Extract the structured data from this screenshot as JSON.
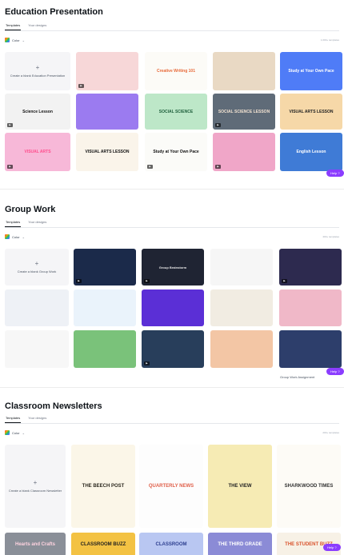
{
  "education": {
    "title": "Education Presentation",
    "tabs": [
      "Templates",
      "Your designs"
    ],
    "filter": "Color",
    "blank_label": "Create a blank Education Presentation",
    "help": "Help ?",
    "cards": [
      {
        "text": "",
        "bg": "#f7d7d8",
        "fg": "#222",
        "video": true
      },
      {
        "text": "Creative Writing 101",
        "bg": "#fcfbf7",
        "fg": "#e86a3a",
        "video": false
      },
      {
        "text": "",
        "bg": "#e9d9c4",
        "fg": "#444",
        "video": false
      },
      {
        "text": "Study at Your Own Pace",
        "bg": "#4f7cf7",
        "fg": "#ffffff",
        "video": false
      },
      {
        "text": "Science Lesson",
        "bg": "#f2f2f2",
        "fg": "#111",
        "video": true
      },
      {
        "text": "",
        "bg": "#9b7bf0",
        "fg": "#fff",
        "video": false
      },
      {
        "text": "SOCIAL SCIENCE",
        "bg": "#bde7c8",
        "fg": "#1c5d3a",
        "video": false
      },
      {
        "text": "SOCIAL SCIENCE LESSON",
        "bg": "#5f6b78",
        "fg": "#f3e3d2",
        "video": true
      },
      {
        "text": "VISUAL ARTS LESSON",
        "bg": "#f6d8a8",
        "fg": "#222",
        "video": false
      },
      {
        "text": "VISUAL ARTS",
        "bg": "#f7b8d8",
        "fg": "#ff4d8d",
        "video": true
      },
      {
        "text": "VISUAL ARTS LESSON",
        "bg": "#faf4ea",
        "fg": "#111",
        "video": false
      },
      {
        "text": "Study at Your Own Pace",
        "bg": "#fbfbf8",
        "fg": "#111",
        "video": true
      },
      {
        "text": "",
        "bg": "#f0a6c8",
        "fg": "#222",
        "video": true
      },
      {
        "text": "English Lesson",
        "bg": "#3f7bd6",
        "fg": "#ffffff",
        "video": false
      }
    ]
  },
  "groupwork": {
    "title": "Group Work",
    "tabs": [
      "Templates",
      "Your designs"
    ],
    "filter": "Color",
    "blank_label": "Create a blank Group Work",
    "help": "Help ?",
    "footer_label": "Group Work Assignment",
    "cards": [
      {
        "text": "",
        "bg": "#1b2a4a",
        "fg": "#fff",
        "video": true
      },
      {
        "text": "Group Brainstorm",
        "bg": "#1f2433",
        "fg": "#e6e6e6",
        "video": true
      },
      {
        "text": "",
        "bg": "#f6f6f6",
        "fg": "#222",
        "video": false
      },
      {
        "text": "",
        "bg": "#2d2a4f",
        "fg": "#fff",
        "video": true
      },
      {
        "text": "",
        "bg": "#eef1f6",
        "fg": "#222",
        "video": false
      },
      {
        "text": "",
        "bg": "#eaf3fb",
        "fg": "#222",
        "video": false
      },
      {
        "text": "",
        "bg": "#5b2fd6",
        "fg": "#fff",
        "video": false
      },
      {
        "text": "",
        "bg": "#f1ece2",
        "fg": "#222",
        "video": false
      },
      {
        "text": "",
        "bg": "#f0b8c8",
        "fg": "#222",
        "video": false
      },
      {
        "text": "",
        "bg": "#f7f7f7",
        "fg": "#222",
        "video": false
      },
      {
        "text": "",
        "bg": "#7ac27a",
        "fg": "#fff",
        "video": false
      },
      {
        "text": "",
        "bg": "#283e5b",
        "fg": "#fff",
        "video": true
      },
      {
        "text": "",
        "bg": "#f3c6a5",
        "fg": "#222",
        "video": false
      },
      {
        "text": "",
        "bg": "#2d3e6b",
        "fg": "#fff",
        "video": false
      },
      {
        "text": "",
        "bg": "#f7e27a",
        "fg": "#222",
        "video": false
      }
    ]
  },
  "newsletters": {
    "title": "Classroom Newsletters",
    "tabs": [
      "Templates",
      "Your designs"
    ],
    "filter": "Color",
    "blank_label": "Create a blank Classroom Newsletter",
    "help": "Help ?",
    "cards": [
      {
        "text": "THE BEECH POST",
        "bg": "#fbf6e8",
        "fg": "#2d2a20",
        "video": false
      },
      {
        "text": "QUARTERLY NEWS",
        "bg": "#fdfdfd",
        "fg": "#e0604a",
        "video": false
      },
      {
        "text": "THE VIEW",
        "bg": "#f6ebb4",
        "fg": "#222",
        "video": false
      },
      {
        "text": "SHARKWOOD TIMES",
        "bg": "#fdfbf6",
        "fg": "#333",
        "video": false
      },
      {
        "text": "Hearts and Crafts",
        "bg": "#8a8f98",
        "fg": "#ffd3e0",
        "video": false
      },
      {
        "text": "CLASSROOM BUZZ",
        "bg": "#f3c243",
        "fg": "#1f1f1f",
        "video": false
      },
      {
        "text": "CLASSROOM",
        "bg": "#b9c7f2",
        "fg": "#2c3e8f",
        "video": false
      },
      {
        "text": "THE THIRD GRADE",
        "bg": "#8b8bd6",
        "fg": "#ffffff",
        "video": false
      },
      {
        "text": "THE STUDENT BUZZ",
        "bg": "#f7f1e6",
        "fg": "#d9532c",
        "video": false
      }
    ]
  }
}
